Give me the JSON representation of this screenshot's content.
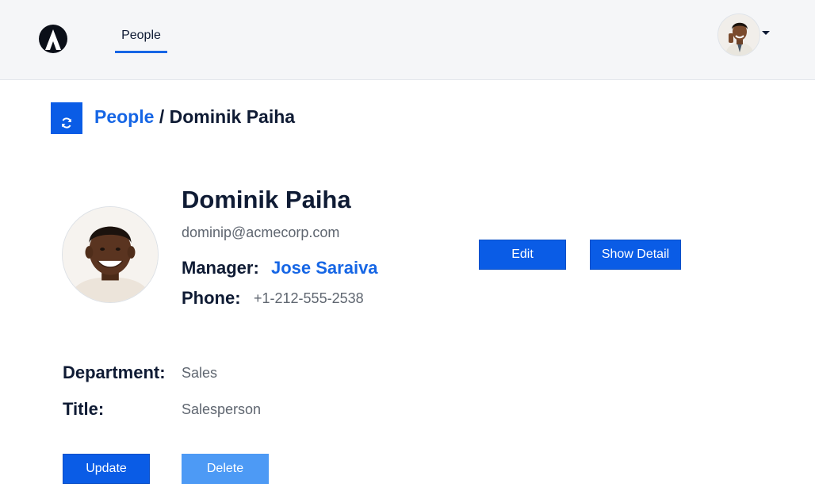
{
  "header": {
    "logo_icon": "acme-logo-icon",
    "nav_tab_label": "People",
    "accent_color": "#1666e5"
  },
  "breadcrumb": {
    "link_label": "People",
    "separator": "/",
    "current": "Dominik Paiha"
  },
  "profile": {
    "name": "Dominik Paiha",
    "email": "dominip@acmecorp.com",
    "manager_label": "Manager:",
    "manager_name": "Jose Saraiva",
    "phone_label": "Phone:",
    "phone_value": "+1-212-555-2538",
    "department_label": "Department:",
    "department_value": "Sales",
    "title_label": "Title:",
    "title_value": "Salesperson"
  },
  "actions": {
    "edit_label": "Edit",
    "show_detail_label": "Show Detail",
    "update_label": "Update",
    "delete_label": "Delete"
  }
}
